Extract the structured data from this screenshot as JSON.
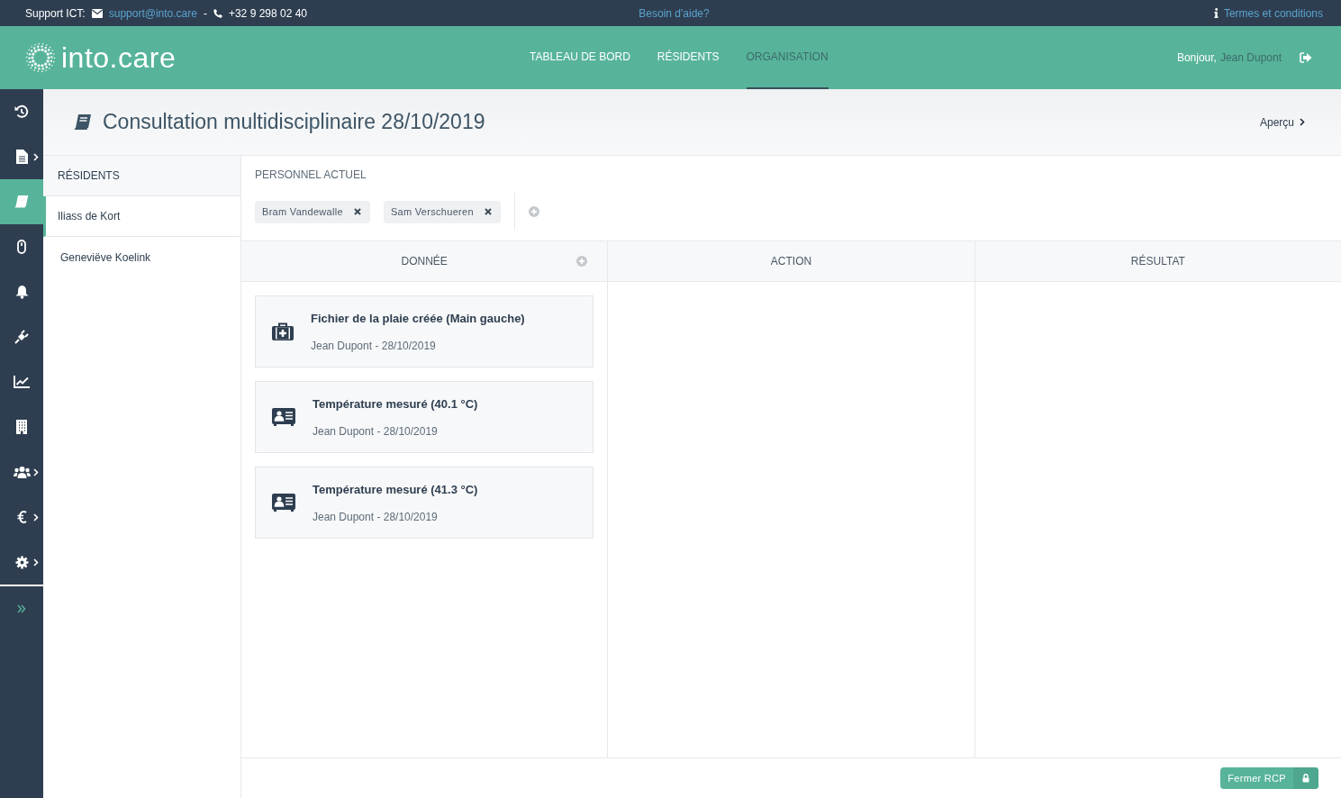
{
  "topbar": {
    "support_label": "Support ICT:",
    "email": "support@into.care",
    "separator": "-",
    "phone": "+32 9 298 02 40",
    "help": "Besoin d'aide?",
    "terms": "Termes et conditions"
  },
  "header": {
    "logo": "into.care",
    "nav": [
      {
        "label": "TABLEAU DE BORD",
        "selected": false
      },
      {
        "label": "RÉSIDENTS",
        "selected": false
      },
      {
        "label": "ORGANISATION",
        "selected": true
      }
    ],
    "greeting": "Bonjour,",
    "user": "Jean Dupont"
  },
  "sidebar": {
    "items": [
      {
        "kind": "history",
        "selected": false,
        "submenu": false
      },
      {
        "kind": "file",
        "selected": false,
        "submenu": true
      },
      {
        "kind": "book",
        "selected": true,
        "submenu": false
      },
      {
        "kind": "mouse",
        "selected": false,
        "submenu": false
      },
      {
        "kind": "bell",
        "selected": false,
        "submenu": false
      },
      {
        "kind": "plug",
        "selected": false,
        "submenu": false
      },
      {
        "kind": "chart",
        "selected": false,
        "submenu": false
      },
      {
        "kind": "building",
        "selected": false,
        "submenu": false
      },
      {
        "kind": "users",
        "selected": false,
        "submenu": true
      },
      {
        "kind": "euro",
        "selected": false,
        "submenu": true
      },
      {
        "kind": "gear",
        "selected": false,
        "submenu": true
      }
    ]
  },
  "page": {
    "title": "Consultation multidisciplinaire 28/10/2019",
    "preview": "Aperçu"
  },
  "residents": {
    "heading": "RÉSIDENTS",
    "items": [
      {
        "name": "Iliass de Kort",
        "selected": true
      },
      {
        "name": "Geneviëve Koelink",
        "selected": false
      }
    ]
  },
  "staff": {
    "heading": "PERSONNEL ACTUEL",
    "tags": [
      "Bram Vandewalle",
      "Sam Verschueren"
    ]
  },
  "columns": [
    {
      "title": "DONNÉE",
      "addable": true,
      "cards": [
        {
          "kind": "medkit",
          "title": "Fichier de la plaie créée (Main gauche)",
          "meta": "Jean Dupont - 28/10/2019"
        },
        {
          "kind": "card",
          "title": "Température mesuré (40.1 °C)",
          "meta": "Jean Dupont - 28/10/2019"
        },
        {
          "kind": "card",
          "title": "Température mesuré (41.3 °C)",
          "meta": "Jean Dupont - 28/10/2019"
        }
      ]
    },
    {
      "title": "ACTION",
      "addable": false
    },
    {
      "title": "RÉSULTAT",
      "addable": false
    }
  ],
  "footer": {
    "close_button": "Fermer RCP"
  }
}
